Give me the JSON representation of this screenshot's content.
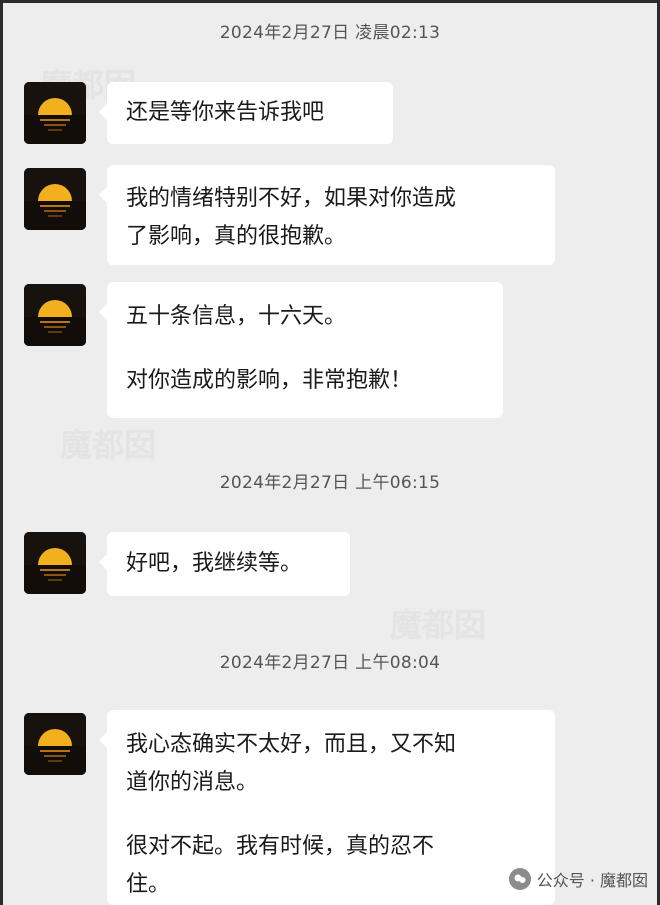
{
  "messages": [
    {
      "time": "2024年2月27日 凌晨02:13",
      "bubbles": [
        {
          "lines": [
            "还是等你来告诉我吧"
          ]
        }
      ]
    },
    {
      "time": "",
      "bubbles": [
        {
          "lines": [
            "我的情绪特别不好，如果对你造成",
            "了影响，真的很抱歉。"
          ]
        }
      ]
    },
    {
      "time": "",
      "bubbles": [
        {
          "lines": [
            "五十条信息，十六天。",
            "",
            "对你造成的影响，非常抱歉！"
          ]
        }
      ]
    },
    {
      "time": "2024年2月27日 上午06:15",
      "bubbles": [
        {
          "lines": [
            "好吧，我继续等。"
          ]
        }
      ]
    },
    {
      "time": "2024年2月27日 上午08:04",
      "bubbles": [
        {
          "lines": [
            "我心态确实不太好，而且，又不知",
            "道你的消息。",
            "",
            "很对不起。我有时候，真的忍不",
            "住。"
          ]
        }
      ]
    }
  ],
  "timestamps": {
    "t1": "2024年2月27日 凌晨02:13",
    "t2": "2024年2月27日 上午06:15",
    "t3": "2024年2月27日 上午08:04"
  },
  "bubble1": {
    "line1": "还是等你来告诉我吧"
  },
  "bubble2": {
    "line1": "我的情绪特别不好，如果对你造成",
    "line2": "了影响，真的很抱歉。"
  },
  "bubble3": {
    "line1": "五十条信息，十六天。",
    "line2": "对你造成的影响，非常抱歉！"
  },
  "bubble4": {
    "line1": "好吧，我继续等。"
  },
  "bubble5": {
    "line1": "我心态确实不太好，而且，又不知",
    "line2": "道你的消息。",
    "line3": "很对不起。我有时候，真的忍不",
    "line4": "住。"
  },
  "watermark": {
    "text": "公众号 · 魔都囡",
    "icon": "wechat-official-account-icon",
    "tile": "魔都囡"
  },
  "colors": {
    "background": "#ededed",
    "bubble": "#ffffff",
    "text": "#1a1a1a",
    "timestamp": "#555555"
  }
}
